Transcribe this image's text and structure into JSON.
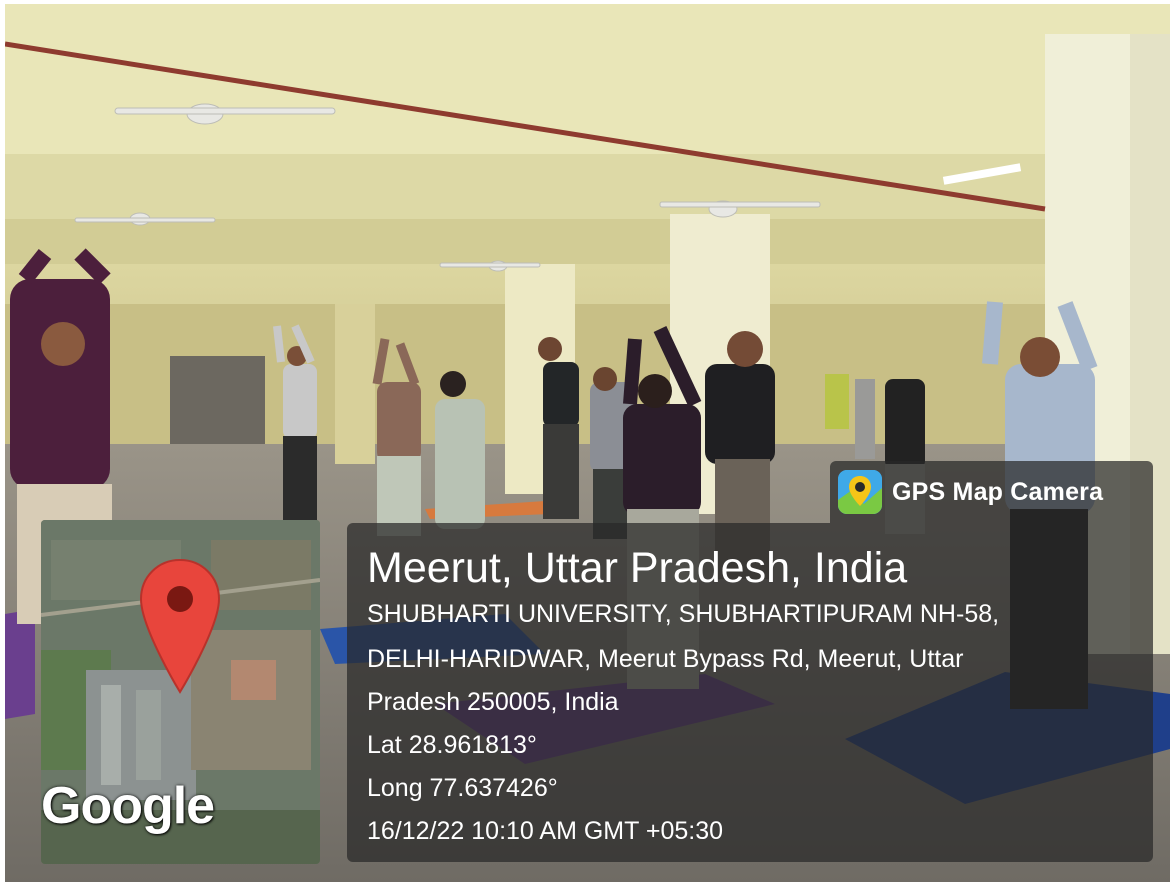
{
  "badge": {
    "title": "GPS Map Camera",
    "icon": "gps-map-camera-app-icon"
  },
  "location": {
    "title": "Meerut, Uttar Pradesh, India",
    "address_line_1": "SHUBHARTI UNIVERSITY, SHUBHARTIPURAM NH-58,",
    "address_line_2": "DELHI-HARIDWAR, Meerut Bypass Rd, Meerut, Uttar",
    "address_line_3": "Pradesh 250005, India",
    "lat": "Lat 28.961813°",
    "long": "Long 77.637426°",
    "datetime": "16/12/22 10:10 AM GMT +05:30"
  },
  "map": {
    "logo_text": "Google",
    "pin_icon": "map-pin-icon",
    "pin_color": "#e8453c"
  },
  "colors": {
    "overlay": "#282828",
    "badge_icon_bg": "#3fa9e8",
    "mat_purple": "#6a3f8e",
    "mat_blue": "#1f3f8a"
  }
}
